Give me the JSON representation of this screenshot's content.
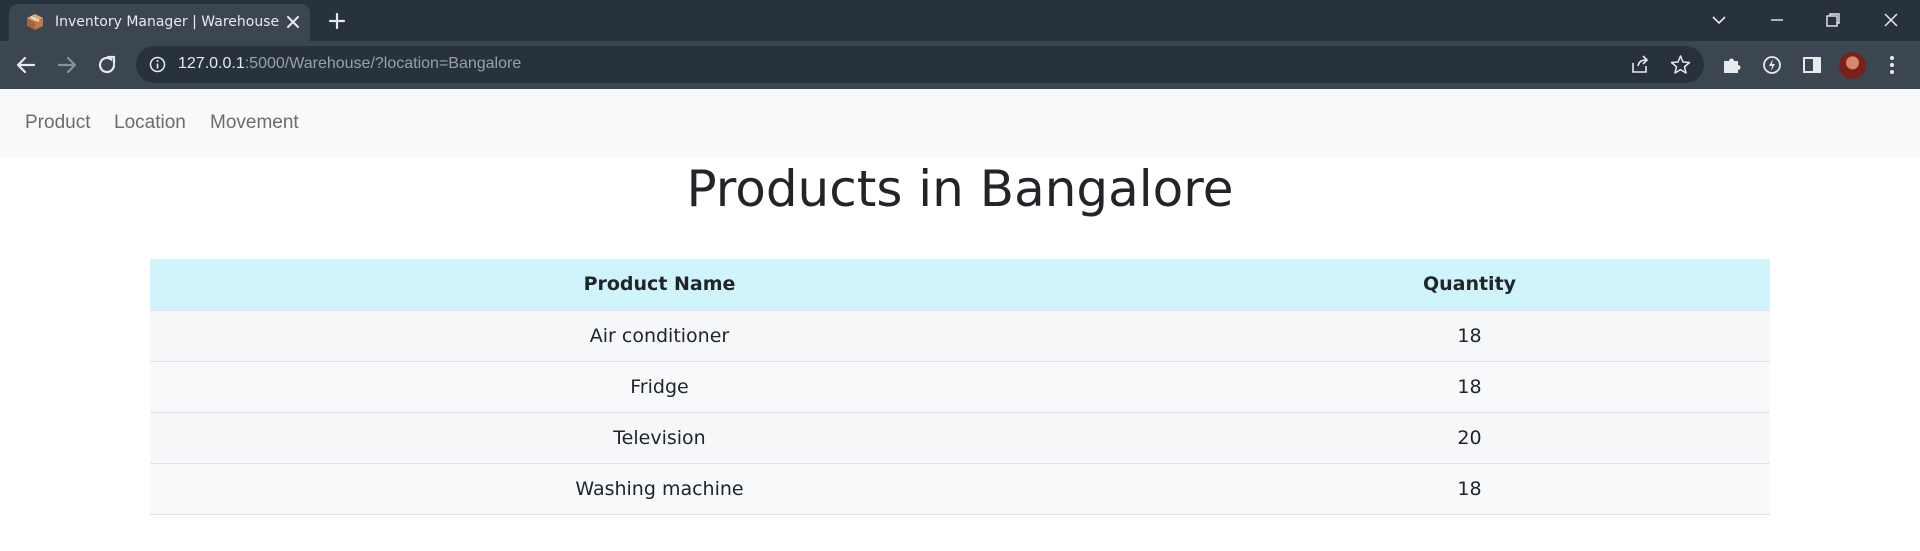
{
  "browser": {
    "tab_title": "Inventory Manager | Warehouse",
    "url_host": "127.0.0.1",
    "url_rest": ":5000/Warehouse/?location=Bangalore"
  },
  "nav": {
    "items": [
      {
        "label": "Product"
      },
      {
        "label": "Location"
      },
      {
        "label": "Movement"
      }
    ]
  },
  "page": {
    "title": "Products in Bangalore"
  },
  "table": {
    "headers": [
      "Product Name",
      "Quantity"
    ],
    "rows": [
      {
        "name": "Air conditioner",
        "quantity": "18"
      },
      {
        "name": "Fridge",
        "quantity": "18"
      },
      {
        "name": "Television",
        "quantity": "20"
      },
      {
        "name": "Washing machine",
        "quantity": "18"
      }
    ]
  },
  "colors": {
    "header_bg": "#cff4fc",
    "navbar_bg": "#f8f9fa",
    "chrome_dark": "#28323c",
    "chrome_toolbar": "#3b4650"
  }
}
